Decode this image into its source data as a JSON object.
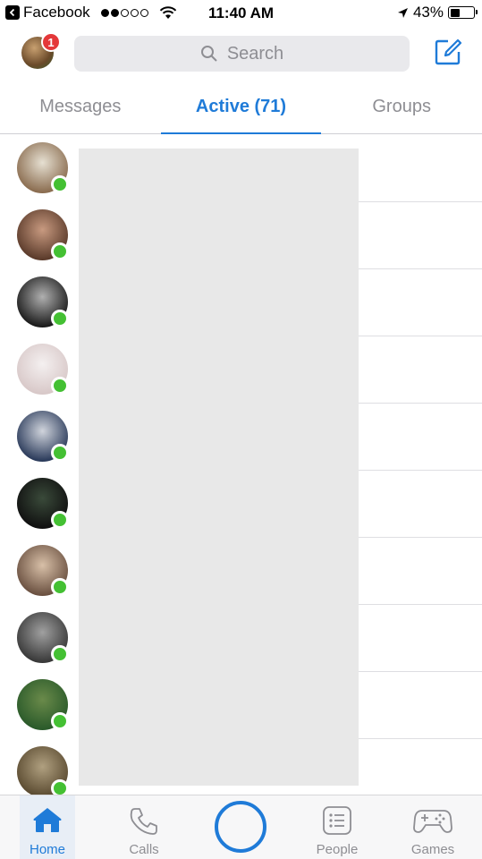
{
  "status_bar": {
    "back_app": "Facebook",
    "time": "11:40 AM",
    "battery": "43%",
    "signal_bars_filled": 2,
    "signal_bars_total": 5,
    "battery_level": 0.43
  },
  "header": {
    "notification_count": "1",
    "search_placeholder": "Search"
  },
  "tabs": [
    {
      "label": "Messages",
      "active": false
    },
    {
      "label": "Active (71)",
      "active": true
    },
    {
      "label": "Groups",
      "active": false
    }
  ],
  "contacts": [
    {
      "colors": [
        "#8a6c4f",
        "#e6e0d2"
      ],
      "online": true
    },
    {
      "colors": [
        "#5a3a2a",
        "#c89a80"
      ],
      "online": true
    },
    {
      "colors": [
        "#1a1a1a",
        "#b0b0b0"
      ],
      "online": true
    },
    {
      "colors": [
        "#d8c8c8",
        "#f4f0f0"
      ],
      "online": true
    },
    {
      "colors": [
        "#2a3a5a",
        "#d0d4dc"
      ],
      "online": true
    },
    {
      "colors": [
        "#101010",
        "#3a4a3a"
      ],
      "online": true
    },
    {
      "colors": [
        "#6a5040",
        "#d8c0a8"
      ],
      "online": true
    },
    {
      "colors": [
        "#383838",
        "#a0a0a0"
      ],
      "online": true
    },
    {
      "colors": [
        "#2a5a2a",
        "#6a8a4a"
      ],
      "online": true
    },
    {
      "colors": [
        "#5a4a30",
        "#b0a080"
      ],
      "online": true
    }
  ],
  "tab_bar": {
    "items": [
      {
        "label": "Home",
        "icon": "home-icon",
        "active": true
      },
      {
        "label": "Calls",
        "icon": "phone-icon",
        "active": false
      },
      {
        "label": "",
        "icon": "camera-button",
        "active": false
      },
      {
        "label": "People",
        "icon": "people-list-icon",
        "active": false
      },
      {
        "label": "Games",
        "icon": "gamepad-icon",
        "active": false
      }
    ]
  },
  "colors": {
    "accent": "#1f7bd8",
    "presence": "#44c033",
    "badge": "#e4383a"
  }
}
